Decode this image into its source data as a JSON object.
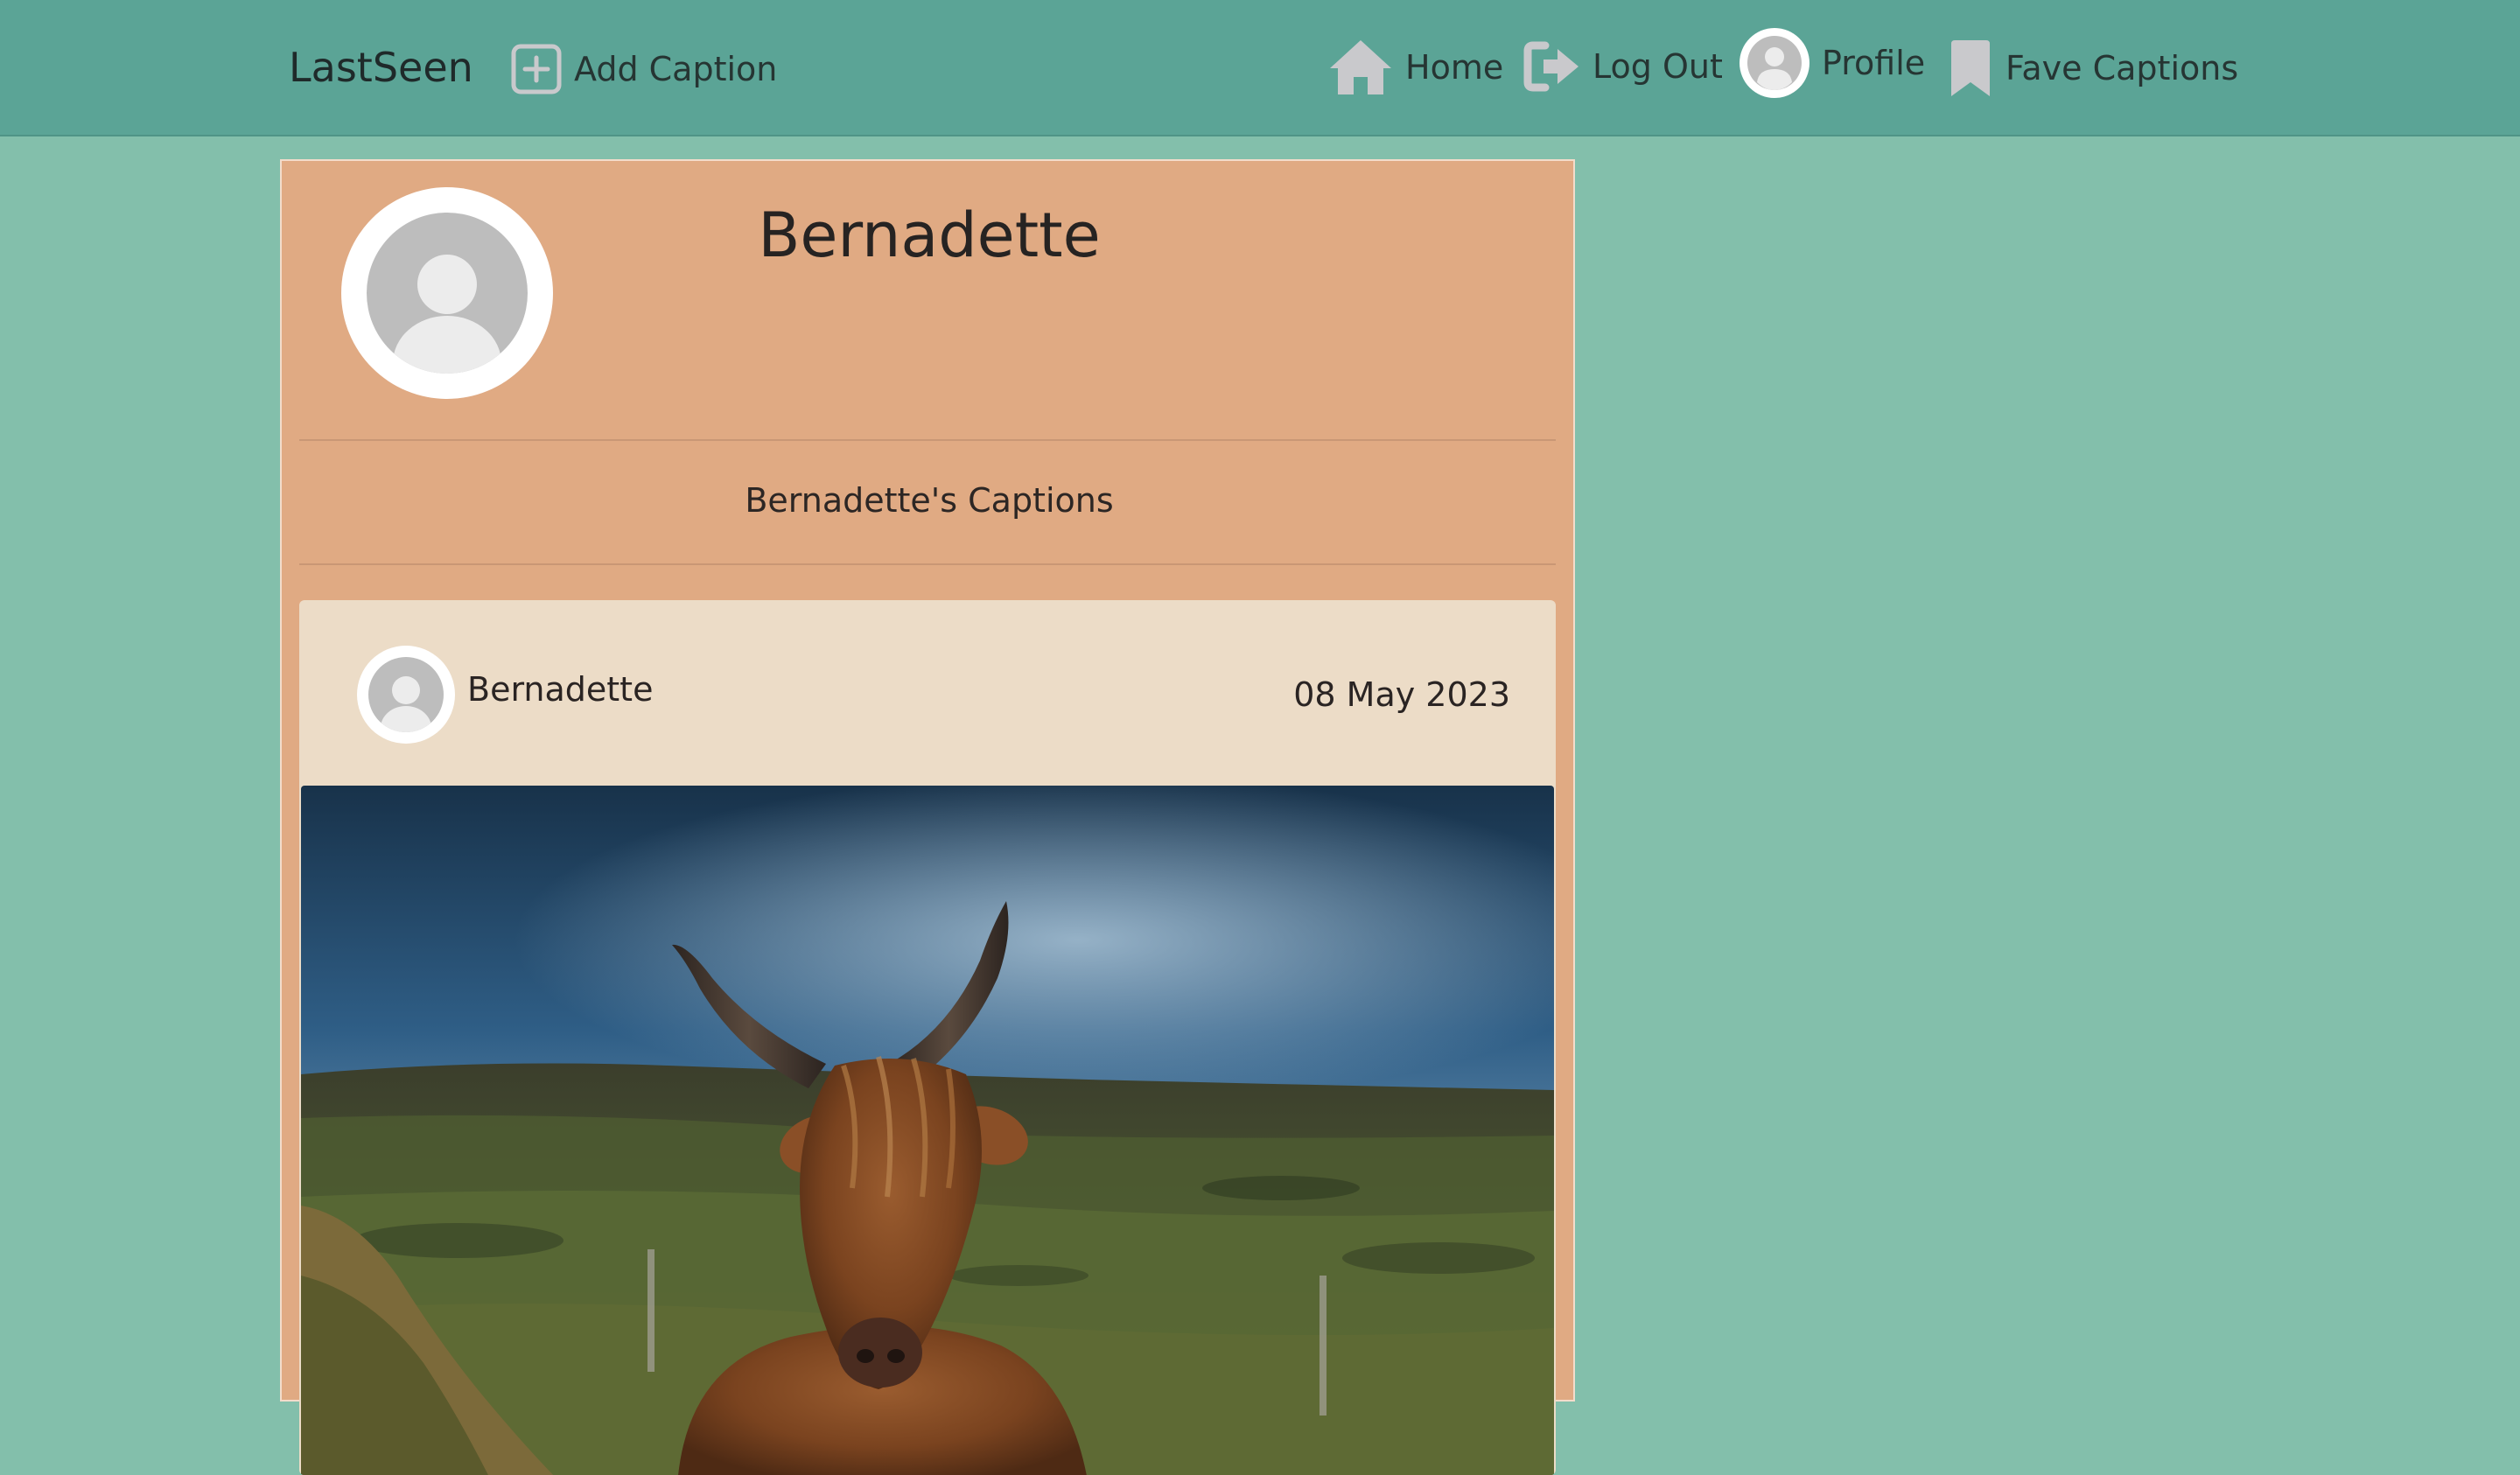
{
  "navbar": {
    "brand": "LastSeen",
    "add_caption": "Add Caption",
    "home": "Home",
    "log_out": "Log Out",
    "profile": "Profile",
    "fave_captions": "Fave Captions",
    "icons": {
      "add": "plus-square-icon",
      "home": "home-icon",
      "log_out": "sign-out-icon",
      "profile": "user-circle-icon",
      "fave": "bookmark-icon"
    }
  },
  "profile": {
    "name": "Bernadette",
    "captions_heading": "Bernadette's Captions"
  },
  "posts": [
    {
      "author": "Bernadette",
      "date": "08 May 2023",
      "image": "highland-cow-photo"
    }
  ],
  "colors": {
    "page_background": "#83bfab",
    "navbar": "#5ba496",
    "profile_card": "#e0aa83",
    "post_card": "#ecdcc7",
    "icon_gray": "#c9c9cc"
  }
}
